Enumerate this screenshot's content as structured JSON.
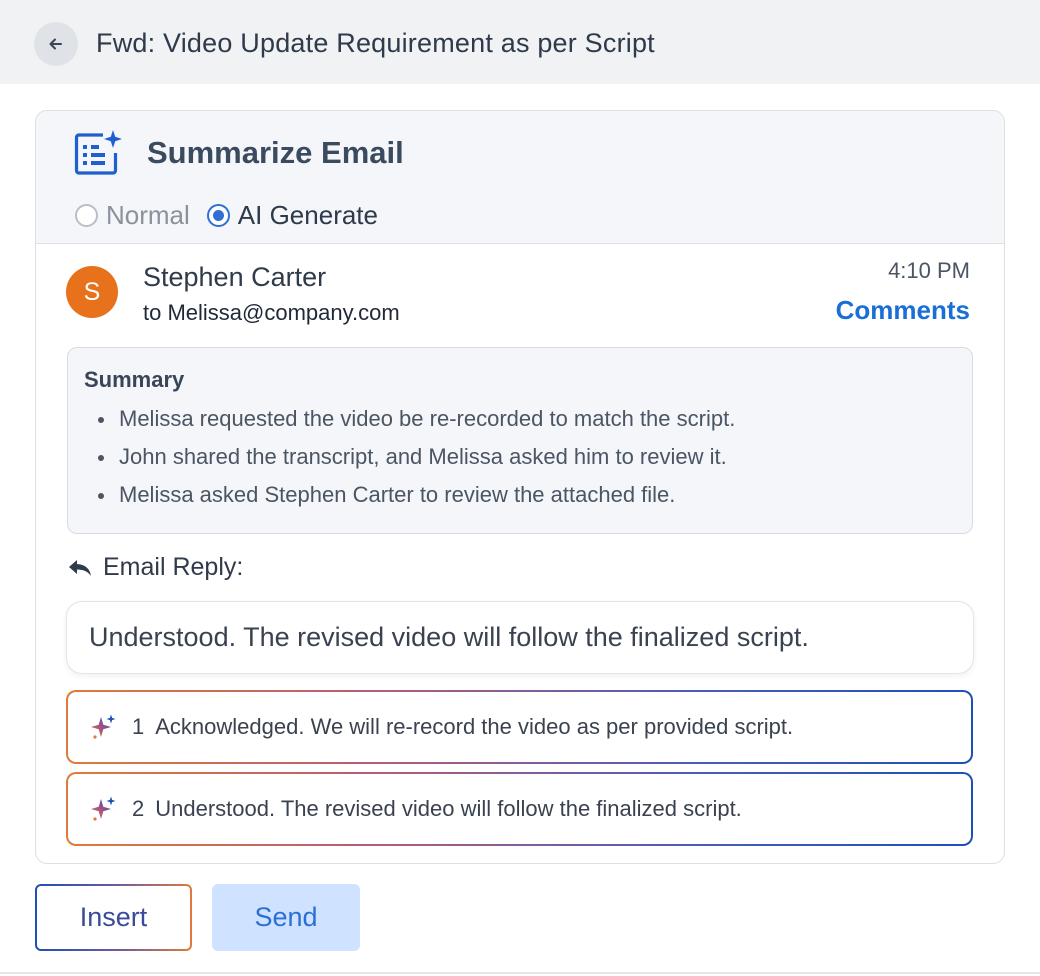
{
  "header": {
    "subject": "Fwd: Video Update Requirement as per Script",
    "back_icon": "arrow-left-icon"
  },
  "summarize": {
    "title": "Summarize Email",
    "icon": "document-sparkle-icon",
    "modes": [
      {
        "label": "Normal",
        "selected": false
      },
      {
        "label": "AI Generate",
        "selected": true
      }
    ]
  },
  "email": {
    "avatar_letter": "S",
    "avatar_color": "#e8711c",
    "sender": "Stephen Carter",
    "recipient": "to Melissa@company.com",
    "time": "4:10 PM",
    "comments_label": "Comments"
  },
  "summary": {
    "title": "Summary",
    "items": [
      "Melissa requested the video be re-recorded to match the script.",
      "John shared the transcript, and Melissa asked him to review it.",
      "Melissa asked Stephen Carter to review the attached file."
    ]
  },
  "reply": {
    "label": "Email Reply:",
    "icon": "reply-arrow-icon",
    "text": "Understood. The revised video will follow the finalized script."
  },
  "suggestions": [
    {
      "number": "1",
      "text": "Acknowledged. We will re-record the video as per provided script.",
      "icon": "ai-sparkle-icon"
    },
    {
      "number": "2",
      "text": "Understood. The revised video will follow the finalized script.",
      "icon": "ai-sparkle-icon"
    }
  ],
  "actions": {
    "insert_label": "Insert",
    "send_label": "Send"
  },
  "colors": {
    "accent": "#1a6fd6",
    "send_bg": "#cfe2ff"
  }
}
